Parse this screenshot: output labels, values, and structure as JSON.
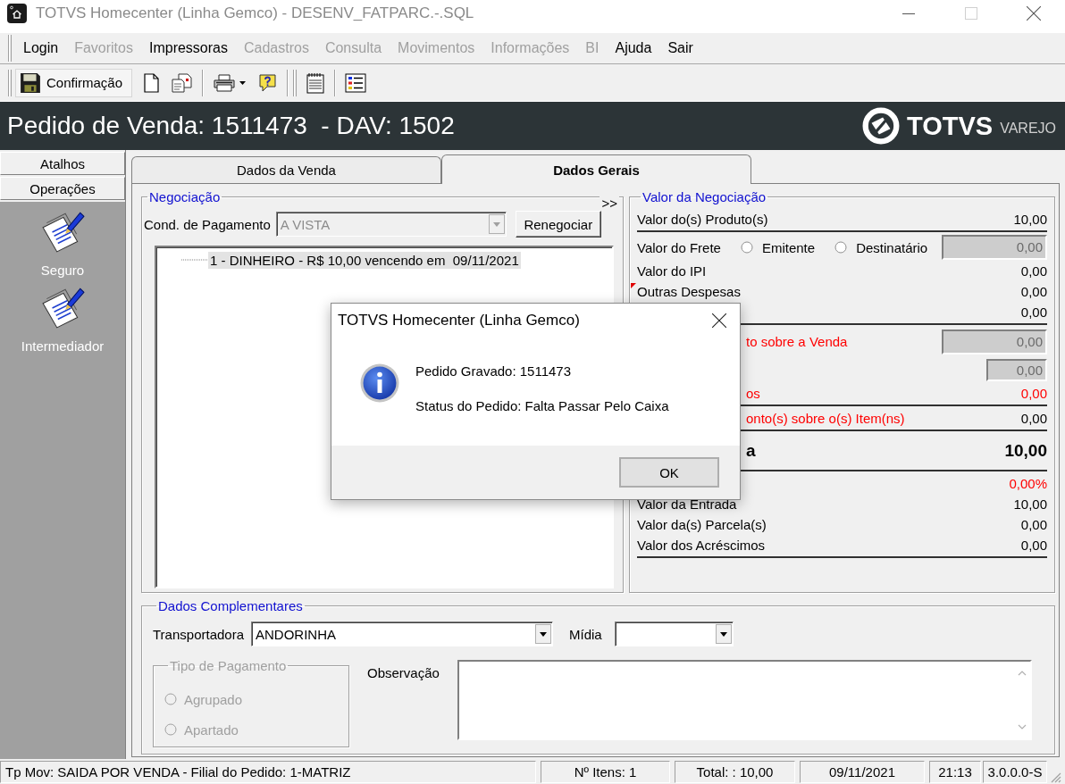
{
  "window": {
    "title": "TOTVS Homecenter (Linha Gemco) - DESENV_FATPARC.-.SQL",
    "active": false,
    "maximize_enabled": false
  },
  "menu": [
    {
      "label": "Login",
      "disabled": false
    },
    {
      "label": "Favoritos",
      "disabled": true
    },
    {
      "label": "Impressoras",
      "disabled": false
    },
    {
      "label": "Cadastros",
      "disabled": true
    },
    {
      "label": "Consulta",
      "disabled": true
    },
    {
      "label": "Movimentos",
      "disabled": true
    },
    {
      "label": "Informações",
      "disabled": true
    },
    {
      "label": "BI",
      "disabled": true
    },
    {
      "label": "Ajuda",
      "disabled": false
    },
    {
      "label": "Sair",
      "disabled": false
    }
  ],
  "toolbar": {
    "confirm_label": "Confirmação"
  },
  "header": {
    "title": "Pedido de Venda: 1511473  - DAV: 1502",
    "brand": "TOTVS",
    "brand_sub": "VAREJO"
  },
  "sidebar": {
    "sections": [
      {
        "label": "Atalhos"
      },
      {
        "label": "Operações"
      }
    ],
    "items": [
      {
        "label": "Seguro"
      },
      {
        "label": "Intermediador"
      }
    ]
  },
  "tabs": [
    {
      "label": "Dados da Venda",
      "selected": false
    },
    {
      "label": "Dados Gerais",
      "selected": true
    }
  ],
  "negotiation": {
    "title": "Negociação",
    "expand": ">>",
    "condition_label": "Cond. de Pagamento",
    "condition_value": "A VISTA",
    "condition_disabled": true,
    "renegotiate": "Renegociar",
    "installments": [
      {
        "label": "1 - DINHEIRO - R$ 10,00 vencendo em  09/11/2021",
        "selected": true
      }
    ]
  },
  "values": {
    "title": "Valor da Negociação",
    "sections": [
      {
        "rows": [
          {
            "kind": "text",
            "label": "Valor do(s) Produto(s)",
            "value": {
              "text": "10,00"
            }
          }
        ]
      },
      {
        "rows": [
          {
            "kind": "options_field",
            "label": "Valor do Frete",
            "options": [
              {
                "label": "Emitente",
                "selected": false
              },
              {
                "label": "Destinatário",
                "selected": false
              }
            ],
            "value": {
              "text": "0,00"
            },
            "disabled": true
          },
          {
            "kind": "text",
            "label": "Valor do IPI",
            "value": {
              "text": "0,00"
            }
          },
          {
            "kind": "text",
            "label": "Outras Despesas",
            "marker": true,
            "value": {
              "text": "0,00"
            }
          },
          {
            "kind": "text",
            "value": {
              "text": "0,00"
            }
          }
        ]
      },
      {
        "rows": [
          {
            "kind": "field",
            "label": "to sobre a Venda",
            "covered": true,
            "color": "#ff0000",
            "value": {
              "text": "0,00"
            },
            "disabled": true
          },
          {
            "kind": "small_field",
            "value": {
              "text": "0,00"
            },
            "disabled": true
          },
          {
            "kind": "text",
            "label": "os",
            "covered": true,
            "color": "#ff0000",
            "value": {
              "text": "0,00",
              "color": "#ff0000"
            }
          }
        ]
      },
      {
        "rows": [
          {
            "kind": "text",
            "label": "onto(s) sobre o(s) Item(ns)",
            "covered": true,
            "color": "#ff0000",
            "value": {
              "text": "0,00"
            }
          }
        ]
      },
      {
        "rows": [
          {
            "kind": "total",
            "label": "a",
            "covered": true,
            "value": {
              "text": "10,00"
            }
          }
        ]
      },
      {
        "rows": [
          {
            "kind": "text",
            "value": {
              "text": "0,00%",
              "color": "#ff0000"
            }
          },
          {
            "kind": "text",
            "label": "Valor da Entrada",
            "value": {
              "text": "10,00"
            }
          },
          {
            "kind": "text",
            "label": "Valor da(s) Parcela(s)",
            "value": {
              "text": "0,00"
            }
          },
          {
            "kind": "text",
            "label": "Valor dos Acréscimos",
            "value": {
              "text": "0,00"
            }
          }
        ]
      }
    ]
  },
  "complement": {
    "title": "Dados Complementares",
    "carrier_label": "Transportadora",
    "carrier_value": "ANDORINHA",
    "media_label": "Mídia",
    "payment_type": {
      "title": "Tipo de Pagamento",
      "disabled": true,
      "options": [
        {
          "label": "Agrupado",
          "selected": false
        },
        {
          "label": "Apartado",
          "selected": false
        }
      ]
    },
    "notes_label": "Observação"
  },
  "status_bar": [
    "Tp Mov: SAIDA POR VENDA - Filial do Pedido: 1-MATRIZ",
    "Nº Itens: 1",
    "Total: : 10,00",
    "09/11/2021",
    "21:13",
    "3.0.0.0-S"
  ],
  "dialog": {
    "title": "TOTVS Homecenter (Linha Gemco)",
    "lines": [
      "Pedido Gravado: 1511473",
      "Status do Pedido: Falta Passar Pelo Caixa"
    ],
    "button": "OK"
  }
}
